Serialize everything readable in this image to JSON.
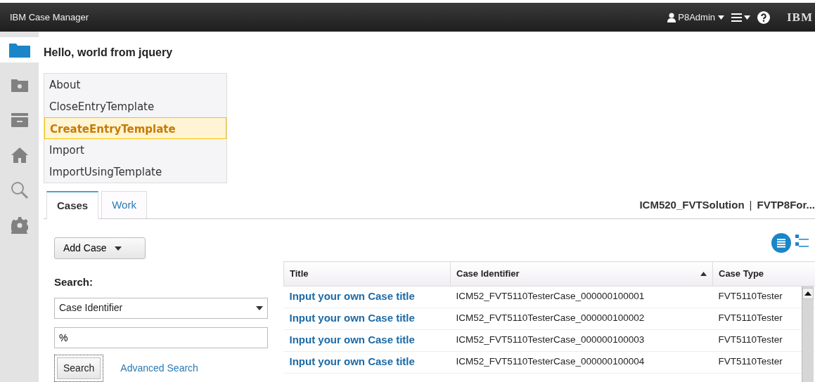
{
  "app_bar": {
    "title": "IBM Case Manager",
    "user": "P8Admin",
    "logo": "IBM"
  },
  "sidebar": {
    "items": [
      {
        "kind": "folder",
        "selected": true
      },
      {
        "kind": "case",
        "selected": false
      },
      {
        "kind": "tray",
        "selected": false
      },
      {
        "kind": "home",
        "selected": false
      },
      {
        "kind": "search",
        "selected": false
      },
      {
        "kind": "settings",
        "selected": false
      }
    ]
  },
  "page_heading": "Hello, world from jquery",
  "menu": [
    {
      "label": "About",
      "selected": false
    },
    {
      "label": "CloseEntryTemplate",
      "selected": false
    },
    {
      "label": "CreateEntryTemplate",
      "selected": true
    },
    {
      "label": "Import",
      "selected": false
    },
    {
      "label": "ImportUsingTemplate",
      "selected": false
    }
  ],
  "tabs": [
    {
      "label": "Cases",
      "selected": true
    },
    {
      "label": "Work",
      "selected": false
    }
  ],
  "context": {
    "solution": "ICM520_FVTSolution",
    "separator": "|",
    "store": "FVTP8For..."
  },
  "add_case_button": "Add Case",
  "search": {
    "label": "Search:",
    "property": "Case Identifier",
    "value": "%",
    "button": "Search",
    "advanced_link": "Advanced Search"
  },
  "view_toggle": [
    {
      "kind": "list",
      "selected": true
    },
    {
      "kind": "tree",
      "selected": false
    }
  ],
  "table": {
    "columns": [
      {
        "label": "Title",
        "sorted": false
      },
      {
        "label": "Case Identifier",
        "sorted": true
      },
      {
        "label": "Case Type",
        "sorted": false
      }
    ],
    "rows": [
      [
        "Input your own Case title",
        "ICM52_FVT5110TesterCase_000000100001",
        "FVT5110Tester"
      ],
      [
        "Input your own Case title",
        "ICM52_FVT5110TesterCase_000000100002",
        "FVT5110Tester"
      ],
      [
        "Input your own Case title",
        "ICM52_FVT5110TesterCase_000000100003",
        "FVT5110Tester"
      ],
      [
        "Input your own Case title",
        "ICM52_FVT5110TesterCase_000000100004",
        "FVT5110Tester"
      ]
    ]
  }
}
